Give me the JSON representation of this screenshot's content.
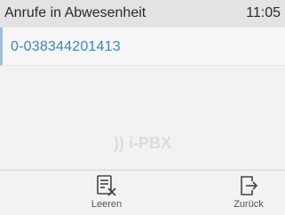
{
  "header": {
    "title": "Anrufe in Abwesenheit",
    "time": "11:05"
  },
  "calls": [
    {
      "number": "0-038344201413"
    }
  ],
  "watermark": ")) i-PBX",
  "softkeys": {
    "clear": {
      "label": "Leeren",
      "icon": "clear-list-icon"
    },
    "back": {
      "label": "Zurück",
      "icon": "exit-icon"
    }
  },
  "colors": {
    "number": "#3b84c6",
    "selection_bar": "#9dbfe0"
  }
}
